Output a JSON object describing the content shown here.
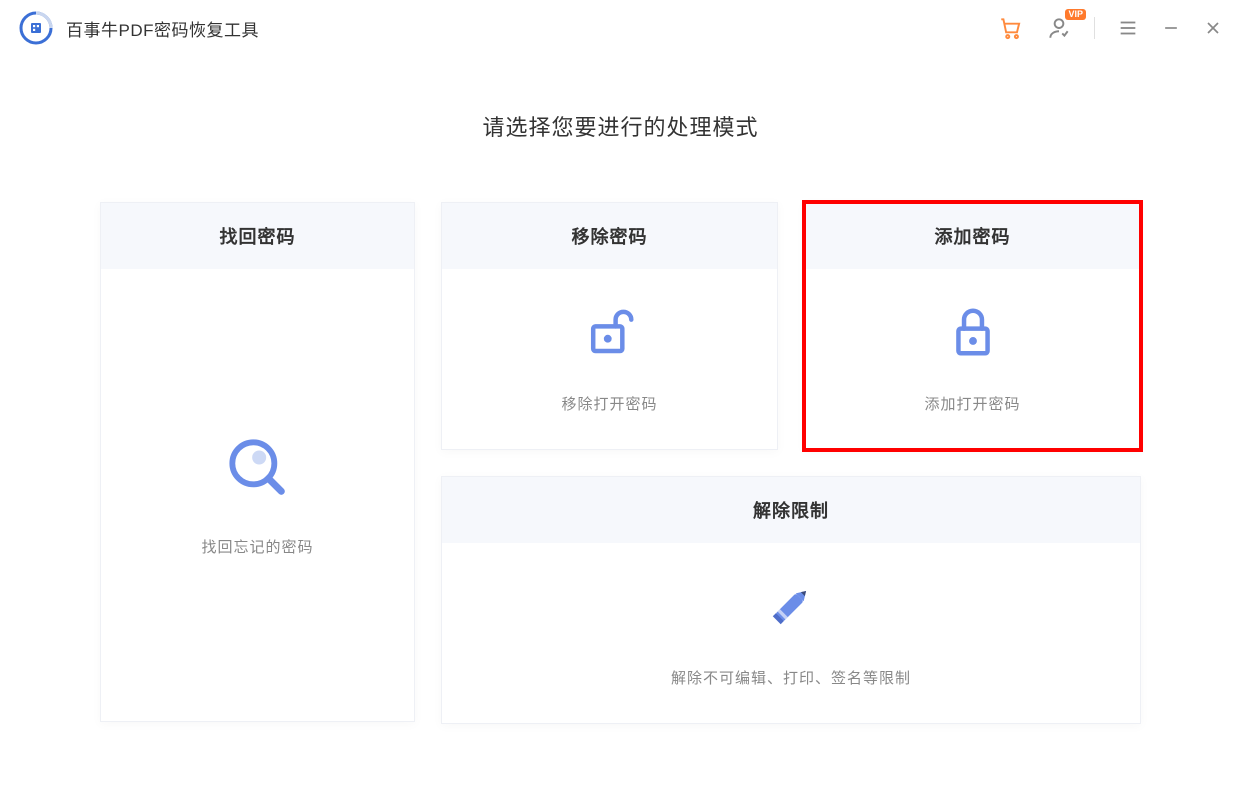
{
  "app": {
    "title": "百事牛PDF密码恢复工具"
  },
  "titlebar": {
    "vip_badge": "VIP"
  },
  "main": {
    "heading": "请选择您要进行的处理模式"
  },
  "cards": {
    "recover": {
      "title": "找回密码",
      "desc": "找回忘记的密码"
    },
    "remove": {
      "title": "移除密码",
      "desc": "移除打开密码"
    },
    "add": {
      "title": "添加密码",
      "desc": "添加打开密码"
    },
    "unrestrict": {
      "title": "解除限制",
      "desc": "解除不可编辑、打印、签名等限制"
    }
  }
}
